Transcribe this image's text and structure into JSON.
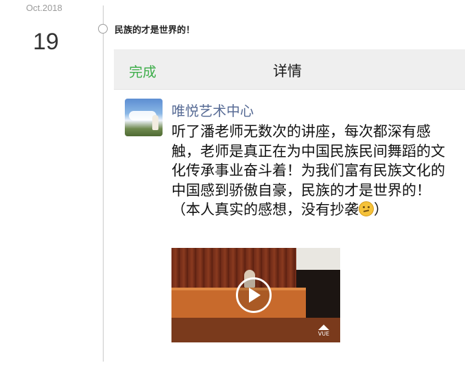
{
  "post": {
    "month": "Oct.2018",
    "day": "19",
    "title": "民族的才是世界的！"
  },
  "screenshot": {
    "nav": {
      "done_label": "完成",
      "title": "详情"
    },
    "message": {
      "sender": "唯悦艺术中心",
      "text": "听了潘老师无数次的讲座，每次都深有感触，老师是真正在为中国民族民间舞蹈的文化传承事业奋斗着！为我们富有民族文化的中国感到骄傲自豪，民族的才是世界的！（本人真实的感想，没有抄袭",
      "text_tail": "）",
      "emoji": "thinking-emoji"
    },
    "video": {
      "play_icon": "play-icon",
      "watermark": "VUE",
      "watermark_icon": "mountain-logo-icon"
    }
  },
  "colors": {
    "done_green": "#3fae4b",
    "sender_blue": "#576b95",
    "nav_bg": "#efefef",
    "timeline_gray": "#c9c9c9"
  }
}
